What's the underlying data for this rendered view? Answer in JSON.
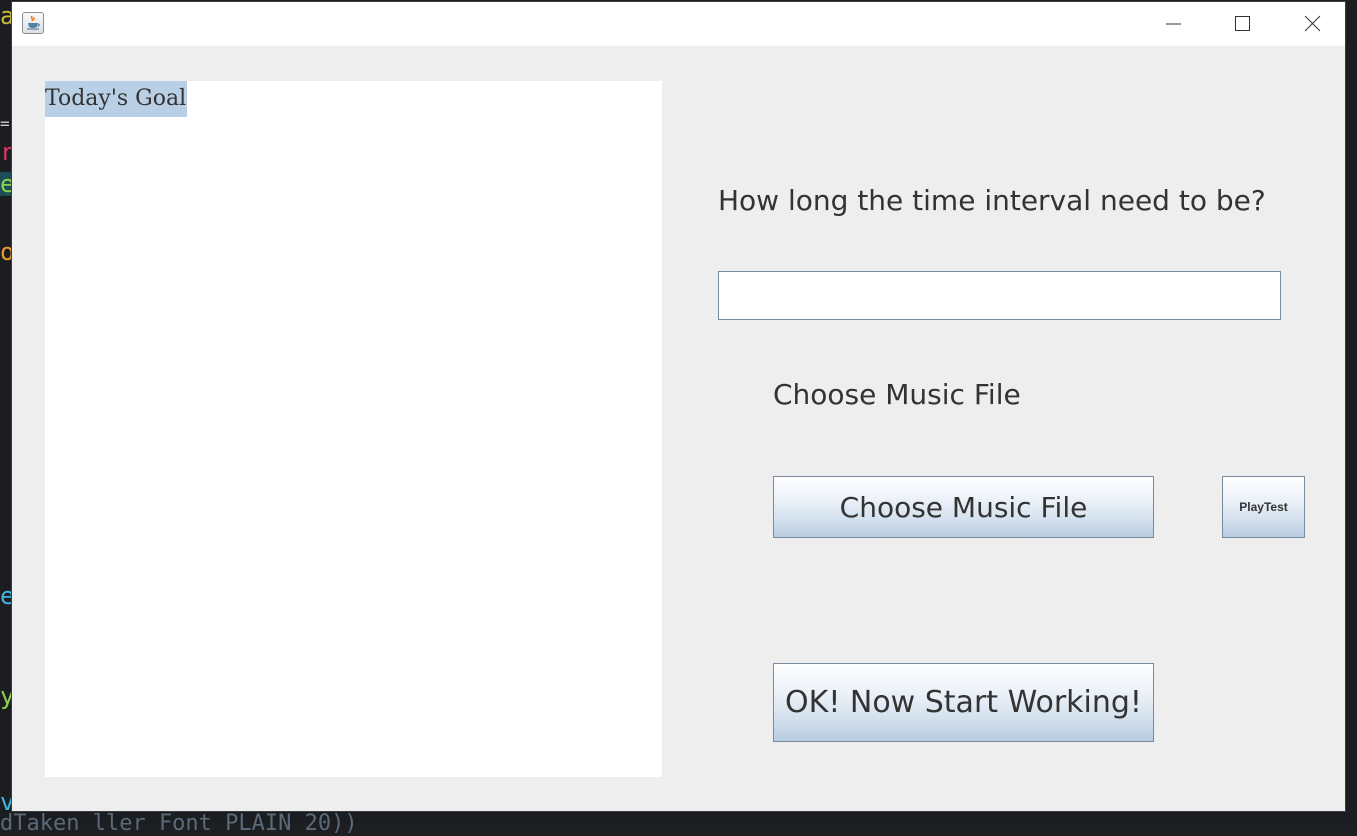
{
  "window": {
    "title": "",
    "app_icon": "java-coffee-cup-icon",
    "controls": [
      "minimize-icon",
      "maximize-icon",
      "close-icon"
    ]
  },
  "goal_area": {
    "text": "Today's Goal"
  },
  "interval": {
    "label": "How long the time interval need to be?",
    "value": "",
    "placeholder": ""
  },
  "music": {
    "label": "Choose Music File",
    "choose_button": "Choose Music File",
    "playtest_button": "PlayTest"
  },
  "start_button": "OK! Now Start Working!",
  "colors": {
    "window_bg": "#eeeeee",
    "selection": "#b8cfe5",
    "button_gradient_top": "#fdfeff",
    "button_gradient_bottom": "#b9cde2",
    "text": "#333333"
  }
}
